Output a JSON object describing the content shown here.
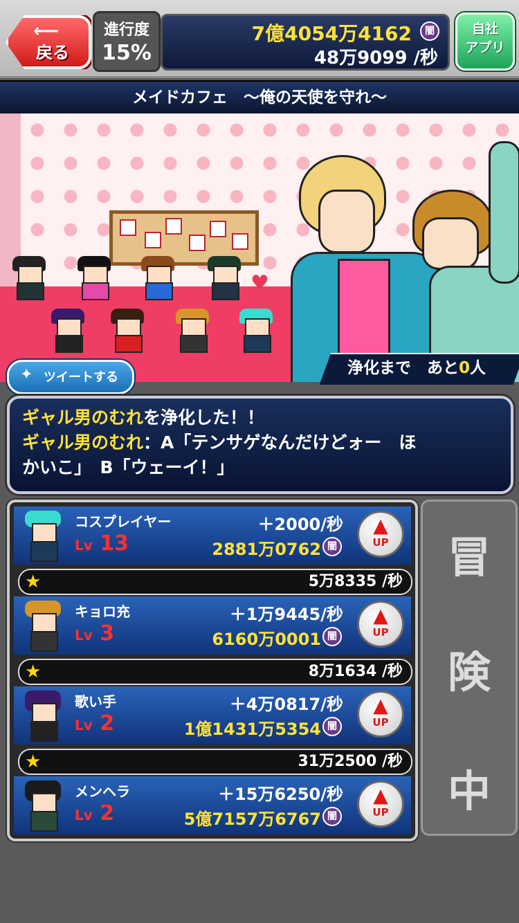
{
  "header": {
    "back_label": "戻る",
    "progress_label": "進行度",
    "progress_value": "15%",
    "money_total": "7億4054万4162",
    "money_rate": "48万9099 /秒",
    "currency_icon": "闇",
    "app_label_1": "自社",
    "app_label_2": "アプリ"
  },
  "stage_title": "メイドカフェ　～俺の天使を守れ～",
  "scene": {
    "tweet_label": "ツイートする",
    "status_prefix": "浄化まで　あと",
    "status_count": "0",
    "status_suffix": "人"
  },
  "message": {
    "line1_highlight": "ギャル男のむれ",
    "line1_text": "を浄化した！！",
    "line2_highlight": "ギャル男のむれ",
    "line2_text": "：A「テンサゲなんだけどォー　ほ",
    "line3_text": "かいこ」　B「ウェーイ！」"
  },
  "units": [
    {
      "name": "コスプレイヤー",
      "lv_prefix": "Lv",
      "lv": "13",
      "rate": "＋2000/秒",
      "cost": "2881万0762",
      "currency": "闇",
      "up_label": "UP",
      "star_value": "5万8335 /秒"
    },
    {
      "name": "キョロ充",
      "lv_prefix": "Lv",
      "lv": "3",
      "rate": "＋1万9445/秒",
      "cost": "6160万0001",
      "currency": "闇",
      "up_label": "UP",
      "star_value": "8万1634 /秒"
    },
    {
      "name": "歌い手",
      "lv_prefix": "Lv",
      "lv": "2",
      "rate": "＋4万0817/秒",
      "cost": "1億1431万5354",
      "currency": "闇",
      "up_label": "UP",
      "star_value": "31万2500 /秒"
    },
    {
      "name": "メンヘラ",
      "lv_prefix": "Lv",
      "lv": "2",
      "rate": "＋15万6250/秒",
      "cost": "5億7157万6767",
      "currency": "闇",
      "up_label": "UP"
    }
  ],
  "side_button": {
    "char1": "冒",
    "char2": "険",
    "char3": "中"
  },
  "colors": {
    "accent_yellow": "#ffe23a",
    "panel_blue": "#10337a",
    "level_red": "#ff3030"
  }
}
